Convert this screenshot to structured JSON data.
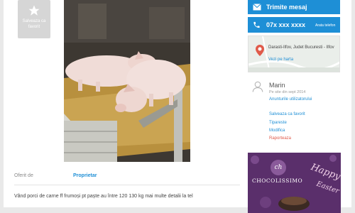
{
  "listing": {
    "save_favorite_label": "Salveaza ca favorit",
    "photo_alt": "pig",
    "offered_by_label": "Oferit de",
    "offered_by_value": "Proprietar",
    "description": "Vând porci de carne ff frumoși pt paște au între 120 130 kg mai multe detalii la tel"
  },
  "contact": {
    "send_message_label": "Trimite mesaj",
    "phone_number": "07x xxx xxxx",
    "show_phone_label": "Arata telefon"
  },
  "location": {
    "address": "Darasti-Ilfov, Judet Bucuresti - Ilfov",
    "view_map_label": "Vezi pe harta"
  },
  "seller": {
    "name": "Marin",
    "since": "Pe site din sept 2014",
    "user_ads_label": "Anunturile utilizatorului"
  },
  "actions": {
    "save_favorite": "Salveaza ca favorit",
    "print": "Tipareste",
    "edit": "Modifica",
    "report": "Raporteaza"
  },
  "ad": {
    "logo_text": "ch",
    "brand": "CHOCOLISSIMO",
    "tagline_1": "Happy",
    "tagline_2": "Easter"
  },
  "colors": {
    "accent": "#1e8fd6",
    "report": "#e05a4a"
  }
}
